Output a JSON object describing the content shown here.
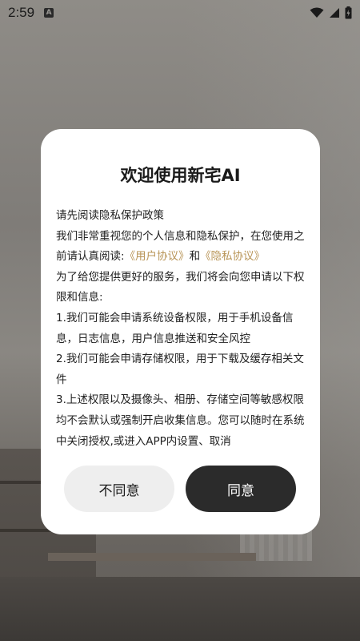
{
  "status_bar": {
    "time": "2:59",
    "notification_badge": "A",
    "icons": [
      "wifi-icon",
      "cell-signal-icon",
      "battery-icon"
    ]
  },
  "dialog": {
    "title": "欢迎使用新宅AI",
    "body": {
      "line1": "请先阅读隐私保护政策",
      "line2_pre": "我们非常重视您的个人信息和隐私保护，在您使用之前请认真阅读:",
      "user_agreement": "《用户协议》",
      "and": "和",
      "privacy_agreement": "《隐私协议》",
      "line3": "为了给您提供更好的服务，我们将会向您申请以下权限和信息:",
      "line4": "1.我们可能会申请系统设备权限，用于手机设备信息，日志信息，用户信息推送和安全风控",
      "line5": "2.我们可能会申请存储权限，用于下载及缓存相关文件",
      "line6": "3.上述权限以及摄像头、相册、存储空间等敏感权限均不会默认或强制开启收集信息。您可以随时在系统中关闭授权,或进入APP内设置、取消"
    },
    "disagree_label": "不同意",
    "agree_label": "同意"
  },
  "colors": {
    "link": "#b89456",
    "agree_button": "#2b2b2b",
    "disagree_button": "#eeeeee"
  }
}
